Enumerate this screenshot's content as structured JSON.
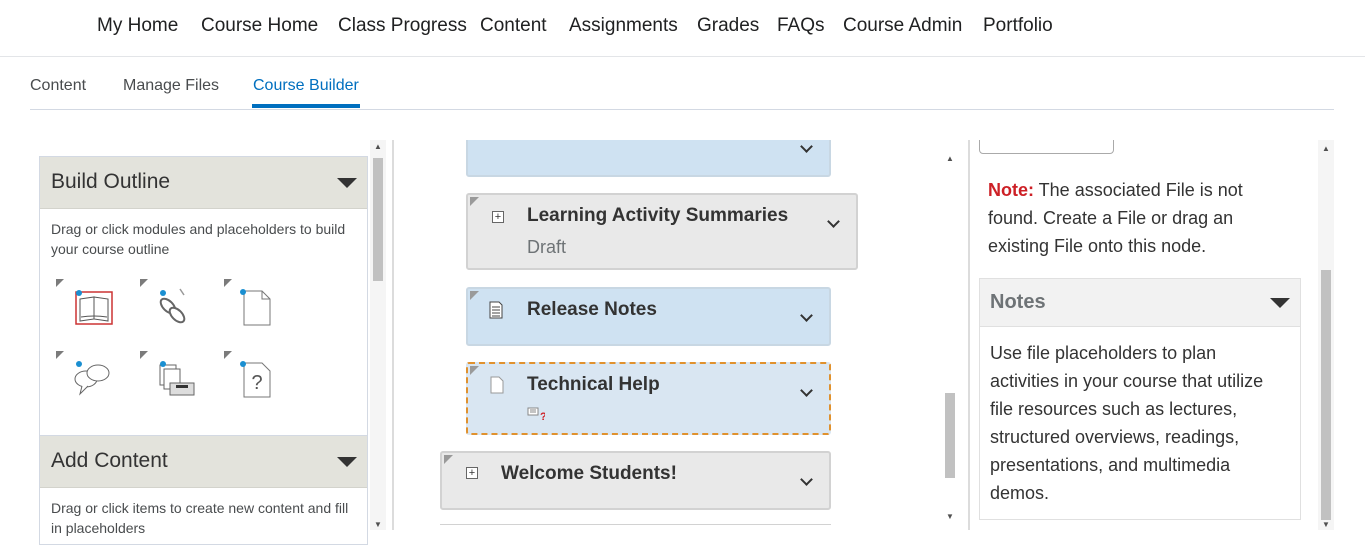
{
  "topnav": {
    "items": [
      "My Home",
      "Course Home",
      "Class Progress",
      "Content",
      "Assignments",
      "Grades",
      "FAQs",
      "Course Admin",
      "Portfolio"
    ]
  },
  "subtabs": {
    "items": [
      "Content",
      "Manage Files",
      "Course Builder"
    ],
    "active": "Course Builder"
  },
  "left": {
    "build_outline": {
      "title": "Build Outline",
      "description": "Drag or click modules and placeholders to build your course outline",
      "tools": [
        "module-icon",
        "link-placeholder-icon",
        "file-placeholder-icon",
        "discussion-icon",
        "dropbox-icon",
        "quiz-icon"
      ]
    },
    "add_content": {
      "title": "Add Content",
      "description": "Drag or click items to create new content and fill in placeholders"
    }
  },
  "middle": {
    "nodes": [
      {
        "title": "Learning Activity Summaries",
        "status": "Draft"
      },
      {
        "title": "Release Notes"
      },
      {
        "title": "Technical Help"
      },
      {
        "title": "Welcome Students!"
      }
    ]
  },
  "right": {
    "note_label": "Note:",
    "note_text": " The associated File is not found. Create a File or drag an existing File onto this node.",
    "notes": {
      "title": "Notes",
      "body": "Use file placeholders to plan activities in your course that utilize file resources such as lectures, structured overviews, readings, presentations, and multimedia demos."
    }
  },
  "colors": {
    "accent": "#006fbf",
    "note_red": "#cd2026",
    "node_blue": "#cfe2f2",
    "dashed_orange": "#e0912e"
  }
}
